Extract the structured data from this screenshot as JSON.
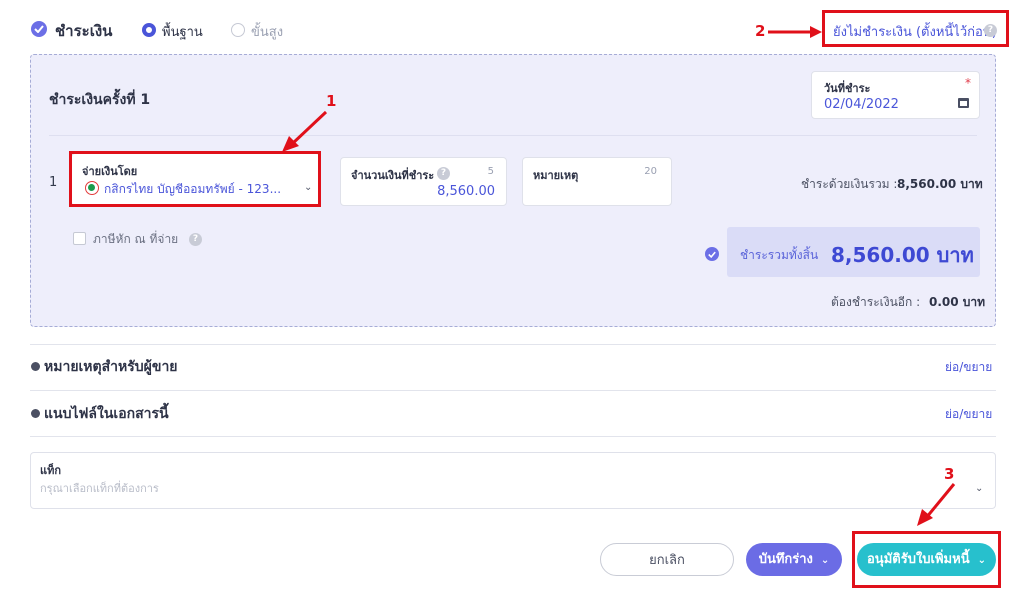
{
  "header": {
    "pay_title": "ชำระเงิน",
    "mode_basic": "พื้นฐาน",
    "mode_advanced": "ขั้นสูง",
    "unpaid_link": "ยังไม่ชำระเงิน (ตั้งหนี้ไว้ก่อน)"
  },
  "payment": {
    "title": "ชำระเงินครั้งที่ 1",
    "date_label": "วันที่ชำระ",
    "date_value": "02/04/2022",
    "required_mark": "*",
    "row_number": "1",
    "pay_by_label": "จ่ายเงินโดย",
    "pay_by_value": "กสิกรไทย บัญชีออมทรัพย์ - 123...",
    "amount_label": "จำนวนเงินที่ชำระ",
    "amount_counter": "5",
    "amount_value": "8,560.00",
    "note_label": "หมายเหตุ",
    "note_counter": "20",
    "total_label": "ชำระด้วยเงินรวม :",
    "total_value": "8,560.00 บาท",
    "wht_label": "ภาษีหัก ณ ที่จ่าย",
    "grand_label": "ชำระรวมทั้งสิ้น",
    "grand_value": "8,560.00 บาท",
    "remaining_label": "ต้องชำระเงินอีก :",
    "remaining_value": "0.00 บาท"
  },
  "annotations": {
    "m1": "1",
    "m2": "2",
    "m3": "3"
  },
  "sections": {
    "seller_note": "หมายเหตุสำหรับผู้ขาย",
    "attachments": "แนบไฟล์ในเอกสารนี้",
    "toggle": "ย่อ/ขยาย"
  },
  "tag": {
    "label": "แท็ก",
    "placeholder": "กรุณาเลือกแท็กที่ต้องการ"
  },
  "footer": {
    "cancel": "ยกเลิก",
    "draft": "บันทึกร่าง",
    "approve": "อนุมัติรับใบเพิ่มหนี้"
  },
  "colors": {
    "accent": "#4a55d9",
    "panel_bg": "#eeeefb",
    "approve": "#27c0cd",
    "draft": "#6b6ce5",
    "annotation": "#e0101a"
  }
}
